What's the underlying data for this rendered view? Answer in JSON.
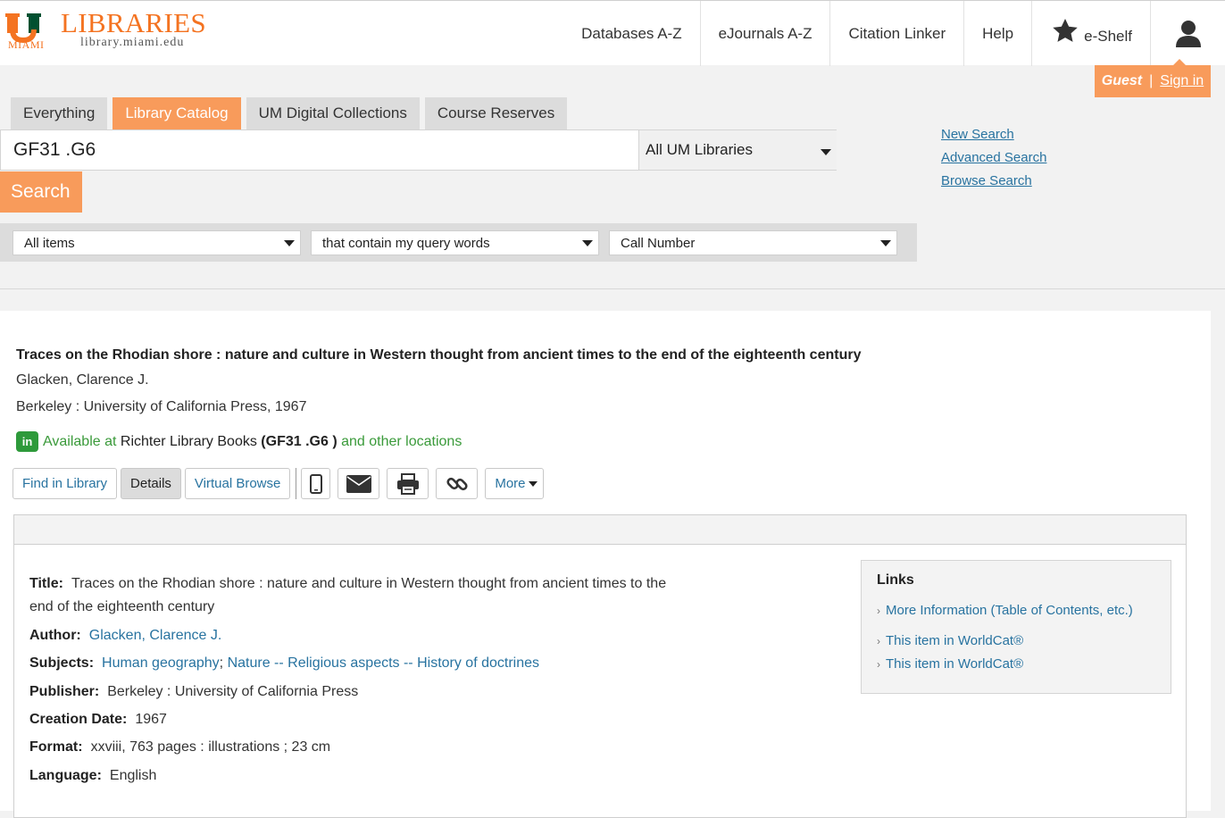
{
  "header": {
    "logo": {
      "miami": "MIAMI",
      "libraries": "LIBRARIES",
      "url": "library.miami.edu"
    },
    "nav": [
      "Databases A-Z",
      "eJournals A-Z",
      "Citation Linker",
      "Help"
    ],
    "eshelf_label": "e-Shelf",
    "guest_label": "Guest",
    "guest_separator": "|",
    "sign_in": "Sign in"
  },
  "search": {
    "tabs": [
      "Everything",
      "Library Catalog",
      "UM Digital Collections",
      "Course Reserves"
    ],
    "active_tab": "Library Catalog",
    "query": "GF31 .G6",
    "scope": "All UM Libraries",
    "button_label": "Search",
    "filters": [
      "All items",
      "that contain my query words",
      "Call Number"
    ],
    "side_links": [
      "New Search",
      "Advanced Search",
      "Browse Search"
    ]
  },
  "result": {
    "title": "Traces on the Rhodian shore : nature and culture in Western thought from ancient times to the end of the eighteenth century",
    "author": "Glacken, Clarence J.",
    "publisher_line": "Berkeley : University of California Press, 1967",
    "availability": {
      "badge": "in",
      "prefix": "Available at",
      "location": "Richter Library Books",
      "call_number": "(GF31 .G6 )",
      "suffix": "and other locations"
    },
    "actions": {
      "find": "Find in Library",
      "details": "Details",
      "virtual_browse": "Virtual Browse",
      "more": "More"
    }
  },
  "details": {
    "title_label": "Title:",
    "title_line1": "Traces on the Rhodian shore : nature and culture in Western thought from ancient times to the",
    "title_line2": "end of the eighteenth century",
    "author_label": "Author:",
    "author_value": "Glacken, Clarence J.",
    "subjects_label": "Subjects:",
    "subject1": "Human geography",
    "subject_sep": ";",
    "subject2": "Nature -- Religious aspects -- History of doctrines",
    "publisher_label": "Publisher:",
    "publisher_value": "Berkeley : University of California Press",
    "date_label": "Creation Date:",
    "date_value": "1967",
    "format_label": "Format:",
    "format_value": "xxviii, 763 pages : illustrations ; 23 cm",
    "language_label": "Language:",
    "language_value": "English"
  },
  "links": {
    "title": "Links",
    "items": [
      "More Information (Table of Contents, etc.)",
      "This item in WorldCat®",
      "This item in WorldCat®"
    ]
  },
  "colors": {
    "accent": "#f89b5b",
    "link": "#2873a0",
    "available": "#3a9a3a"
  }
}
